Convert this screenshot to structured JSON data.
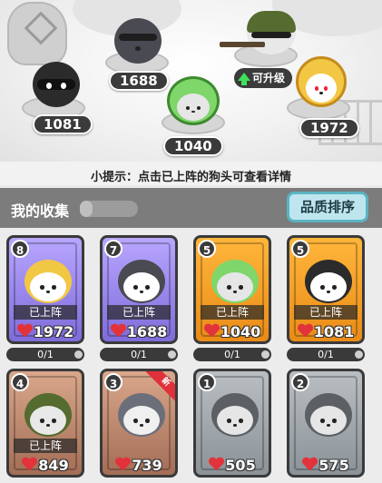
{
  "arena": {
    "slots": [
      {
        "id": "ninja",
        "power": "1081",
        "skin": "#2b2b2b",
        "accent": "#1e1e1e"
      },
      {
        "id": "sunglasses",
        "power": "1688",
        "skin": "#4a4a52",
        "accent": "#ffffff"
      },
      {
        "id": "dino",
        "power": "1040",
        "skin": "#7fd66a",
        "accent": "#e8e8e8"
      },
      {
        "id": "soldier",
        "power": "",
        "skin": "#556b2f",
        "accent": "#e8e8e8"
      },
      {
        "id": "golden-warrior",
        "power": "1972",
        "skin": "#f2c744",
        "accent": "#ffffff"
      }
    ],
    "upgrade_label": "可升级"
  },
  "hint": "小提示：点击已上阵的狗头可查看详情",
  "collection": {
    "title": "我的收集",
    "progress_fraction": 0.22,
    "sort_button": "品质排序",
    "deployed_label": "已上阵",
    "cards": [
      {
        "level": "8",
        "quality": "purple",
        "power": "1972",
        "count": "0/1",
        "deployed": true,
        "new": false,
        "dog": "golden-warrior"
      },
      {
        "level": "7",
        "quality": "purple",
        "power": "1688",
        "count": "0/1",
        "deployed": true,
        "new": false,
        "dog": "sunglasses"
      },
      {
        "level": "5",
        "quality": "orange",
        "power": "1040",
        "count": "0/1",
        "deployed": true,
        "new": false,
        "dog": "dino"
      },
      {
        "level": "5",
        "quality": "orange",
        "power": "1081",
        "count": "0/1",
        "deployed": true,
        "new": false,
        "dog": "ninja"
      },
      {
        "level": "4",
        "quality": "bronze",
        "power": "849",
        "count": "",
        "deployed": true,
        "new": false,
        "dog": "soldier"
      },
      {
        "level": "3",
        "quality": "bronze",
        "power": "739",
        "count": "",
        "deployed": false,
        "new": true,
        "dog": "pacifier"
      },
      {
        "level": "1",
        "quality": "gray",
        "power": "505",
        "count": "",
        "deployed": false,
        "new": false,
        "dog": "cool-shiba"
      },
      {
        "level": "2",
        "quality": "gray",
        "power": "575",
        "count": "",
        "deployed": false,
        "new": false,
        "dog": "husky"
      }
    ],
    "new_badge": "新"
  },
  "colors": {
    "purple": "#8f7be6",
    "orange": "#f0a12a",
    "bronze": "#c08a72",
    "gray": "#a3aaaf",
    "heart": "#e2333b"
  }
}
